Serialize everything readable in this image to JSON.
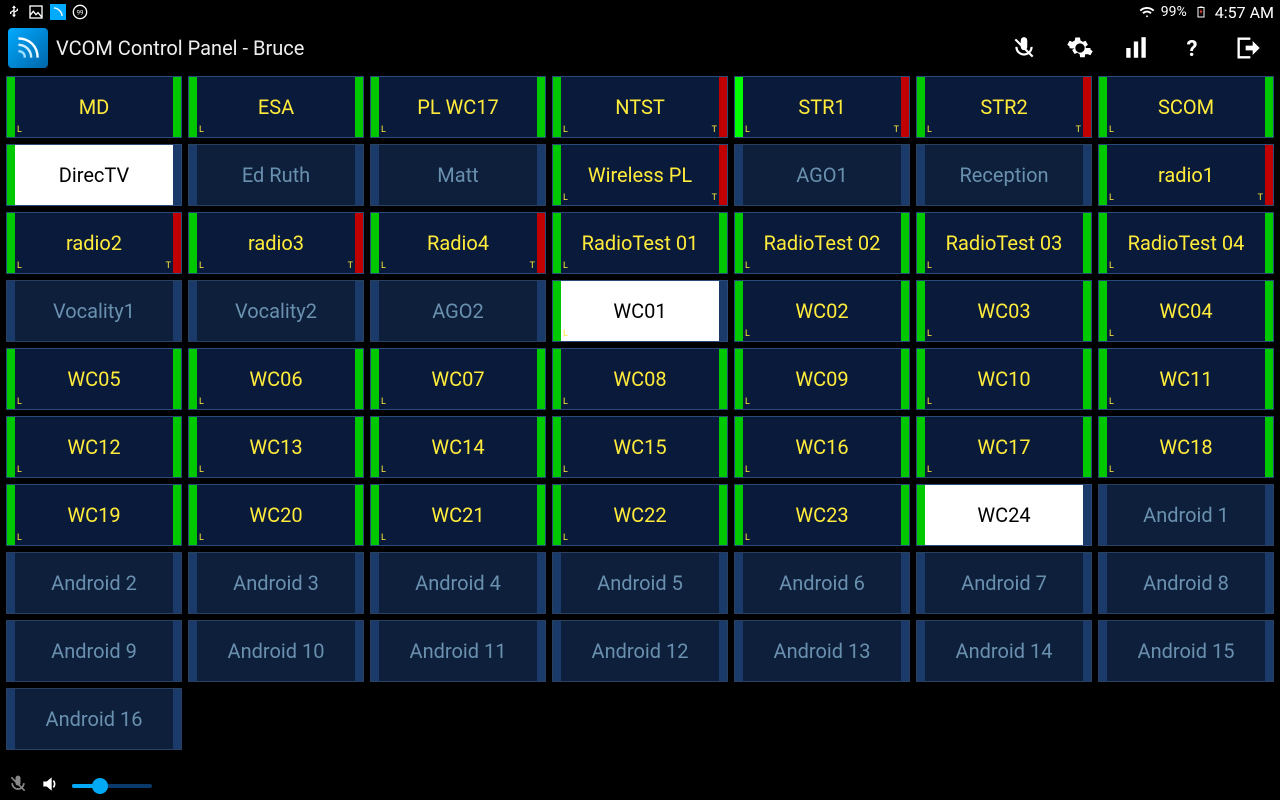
{
  "statusbar": {
    "battery": "99%",
    "time": "4:57 AM"
  },
  "app": {
    "title": "VCOM Control Panel - Bruce"
  },
  "grid": [
    {
      "label": "MD",
      "style": "active",
      "left": "g",
      "right": "g",
      "tagBL": "L"
    },
    {
      "label": "ESA",
      "style": "active",
      "left": "g",
      "right": "g",
      "tagBL": "L"
    },
    {
      "label": "PL WC17",
      "style": "active",
      "left": "g",
      "right": "g",
      "tagBL": "L"
    },
    {
      "label": "NTST",
      "style": "active",
      "left": "g",
      "right": "r",
      "tagBL": "L",
      "tagBR": "T"
    },
    {
      "label": "STR1",
      "style": "active",
      "left": "gb",
      "right": "r",
      "tagBL": "L",
      "tagBR": "T"
    },
    {
      "label": "STR2",
      "style": "active",
      "left": "g",
      "right": "r",
      "tagBL": "L",
      "tagBR": "T"
    },
    {
      "label": "SCOM",
      "style": "active",
      "left": "g",
      "right": "g",
      "tagBL": "L"
    },
    {
      "label": "DirecTV",
      "style": "selected",
      "left": "g",
      "right": "d",
      "tagBL": ""
    },
    {
      "label": "Ed Ruth",
      "style": "inactive",
      "left": "d",
      "right": "d"
    },
    {
      "label": "Matt",
      "style": "inactive",
      "left": "d",
      "right": "d"
    },
    {
      "label": "Wireless PL",
      "style": "active",
      "left": "g",
      "right": "r",
      "tagBL": "L",
      "tagBR": "T"
    },
    {
      "label": "AGO1",
      "style": "inactive",
      "left": "d",
      "right": "d"
    },
    {
      "label": "Reception",
      "style": "inactive",
      "left": "d",
      "right": "d"
    },
    {
      "label": "radio1",
      "style": "active",
      "left": "g",
      "right": "r",
      "tagBL": "L",
      "tagBR": "T"
    },
    {
      "label": "radio2",
      "style": "active",
      "left": "g",
      "right": "r",
      "tagBL": "L",
      "tagBR": "T"
    },
    {
      "label": "radio3",
      "style": "active",
      "left": "g",
      "right": "r",
      "tagBL": "L",
      "tagBR": "T"
    },
    {
      "label": "Radio4",
      "style": "active",
      "left": "g",
      "right": "r",
      "tagBL": "L",
      "tagBR": "T"
    },
    {
      "label": "RadioTest 01",
      "style": "active",
      "left": "g",
      "right": "g",
      "tagBL": "L"
    },
    {
      "label": "RadioTest 02",
      "style": "active",
      "left": "g",
      "right": "g",
      "tagBL": "L"
    },
    {
      "label": "RadioTest 03",
      "style": "active",
      "left": "g",
      "right": "g",
      "tagBL": "L"
    },
    {
      "label": "RadioTest 04",
      "style": "active",
      "left": "g",
      "right": "g",
      "tagBL": "L"
    },
    {
      "label": "Vocality1",
      "style": "inactive",
      "left": "d",
      "right": "d"
    },
    {
      "label": "Vocality2",
      "style": "inactive",
      "left": "d",
      "right": "d"
    },
    {
      "label": "AGO2",
      "style": "inactive",
      "left": "d",
      "right": "d"
    },
    {
      "label": "WC01",
      "style": "selected",
      "left": "g",
      "right": "d",
      "tagBL": "L"
    },
    {
      "label": "WC02",
      "style": "active",
      "left": "g",
      "right": "g",
      "tagBL": "L"
    },
    {
      "label": "WC03",
      "style": "active",
      "left": "g",
      "right": "g",
      "tagBL": "L"
    },
    {
      "label": "WC04",
      "style": "active",
      "left": "g",
      "right": "g",
      "tagBL": "L"
    },
    {
      "label": "WC05",
      "style": "active",
      "left": "g",
      "right": "g",
      "tagBL": "L"
    },
    {
      "label": "WC06",
      "style": "active",
      "left": "g",
      "right": "g",
      "tagBL": "L"
    },
    {
      "label": "WC07",
      "style": "active",
      "left": "g",
      "right": "g",
      "tagBL": "L"
    },
    {
      "label": "WC08",
      "style": "active",
      "left": "g",
      "right": "g",
      "tagBL": "L"
    },
    {
      "label": "WC09",
      "style": "active",
      "left": "g",
      "right": "g",
      "tagBL": "L"
    },
    {
      "label": "WC10",
      "style": "active",
      "left": "g",
      "right": "g",
      "tagBL": "L"
    },
    {
      "label": "WC11",
      "style": "active",
      "left": "g",
      "right": "g",
      "tagBL": "L"
    },
    {
      "label": "WC12",
      "style": "active",
      "left": "g",
      "right": "g",
      "tagBL": "L"
    },
    {
      "label": "WC13",
      "style": "active",
      "left": "g",
      "right": "g",
      "tagBL": "L"
    },
    {
      "label": "WC14",
      "style": "active",
      "left": "g",
      "right": "g",
      "tagBL": "L"
    },
    {
      "label": "WC15",
      "style": "active",
      "left": "g",
      "right": "g",
      "tagBL": "L"
    },
    {
      "label": "WC16",
      "style": "active",
      "left": "g",
      "right": "g",
      "tagBL": "L"
    },
    {
      "label": "WC17",
      "style": "active",
      "left": "g",
      "right": "g",
      "tagBL": "L"
    },
    {
      "label": "WC18",
      "style": "active",
      "left": "g",
      "right": "g",
      "tagBL": "L"
    },
    {
      "label": "WC19",
      "style": "active",
      "left": "g",
      "right": "g",
      "tagBL": "L"
    },
    {
      "label": "WC20",
      "style": "active",
      "left": "g",
      "right": "g",
      "tagBL": "L"
    },
    {
      "label": "WC21",
      "style": "active",
      "left": "g",
      "right": "g",
      "tagBL": "L"
    },
    {
      "label": "WC22",
      "style": "active",
      "left": "g",
      "right": "g",
      "tagBL": "L"
    },
    {
      "label": "WC23",
      "style": "active",
      "left": "g",
      "right": "g",
      "tagBL": "L"
    },
    {
      "label": "WC24",
      "style": "selected",
      "left": "g",
      "right": "d",
      "tagBL": ""
    },
    {
      "label": "Android  1",
      "style": "inactive",
      "left": "d",
      "right": "d"
    },
    {
      "label": "Android  2",
      "style": "inactive",
      "left": "d",
      "right": "d"
    },
    {
      "label": "Android  3",
      "style": "inactive",
      "left": "d",
      "right": "d"
    },
    {
      "label": "Android  4",
      "style": "inactive",
      "left": "d",
      "right": "d"
    },
    {
      "label": "Android  5",
      "style": "inactive",
      "left": "d",
      "right": "d"
    },
    {
      "label": "Android  6",
      "style": "inactive",
      "left": "d",
      "right": "d"
    },
    {
      "label": "Android  7",
      "style": "inactive",
      "left": "d",
      "right": "d"
    },
    {
      "label": "Android  8",
      "style": "inactive",
      "left": "d",
      "right": "d"
    },
    {
      "label": "Android  9",
      "style": "inactive",
      "left": "d",
      "right": "d"
    },
    {
      "label": "Android 10",
      "style": "inactive",
      "left": "d",
      "right": "d"
    },
    {
      "label": "Android 11",
      "style": "inactive",
      "left": "d",
      "right": "d"
    },
    {
      "label": "Android 12",
      "style": "inactive",
      "left": "d",
      "right": "d"
    },
    {
      "label": "Android 13",
      "style": "inactive",
      "left": "d",
      "right": "d"
    },
    {
      "label": "Android 14",
      "style": "inactive",
      "left": "d",
      "right": "d"
    },
    {
      "label": "Android 15",
      "style": "inactive",
      "left": "d",
      "right": "d"
    },
    {
      "label": "Android 16",
      "style": "inactive",
      "left": "d",
      "right": "d"
    }
  ],
  "bottom": {
    "volumePercent": 35
  }
}
